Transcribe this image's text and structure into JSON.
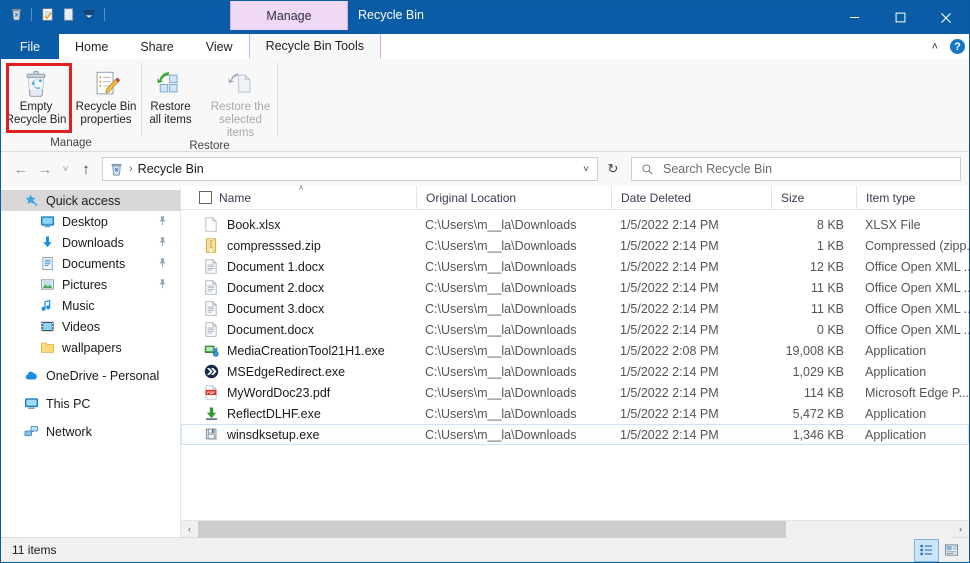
{
  "titlebar": {
    "quick_access": [
      {
        "name": "recycle-bin-icon",
        "label": "Recycle Bin"
      },
      {
        "name": "properties-icon",
        "label": "Properties"
      },
      {
        "name": "new-folder-icon",
        "label": "New folder"
      },
      {
        "name": "customize-dropdown-icon",
        "label": "Customize Quick Access Toolbar"
      }
    ],
    "contextual_tab": "Manage",
    "title": "Recycle Bin",
    "minimize": "–",
    "maximize": "☐",
    "close": "✕"
  },
  "tabs": {
    "file": "File",
    "items": [
      {
        "label": "Home",
        "active": false
      },
      {
        "label": "Share",
        "active": false
      },
      {
        "label": "View",
        "active": false
      },
      {
        "label": "Recycle Bin Tools",
        "active": true
      }
    ],
    "collapse_ribbon": "˄",
    "help": "?"
  },
  "ribbon": {
    "groups": [
      {
        "label": "Manage",
        "buttons": [
          {
            "name": "empty-recycle-bin-button",
            "line1": "Empty",
            "line2": "Recycle Bin",
            "disabled": false,
            "highlighted": true
          },
          {
            "name": "recycle-bin-properties-button",
            "line1": "Recycle Bin",
            "line2": "properties",
            "disabled": false,
            "highlighted": false
          }
        ]
      },
      {
        "label": "Restore",
        "buttons": [
          {
            "name": "restore-all-items-button",
            "line1": "Restore",
            "line2": "all items",
            "disabled": false,
            "highlighted": false
          },
          {
            "name": "restore-selected-items-button",
            "line1": "Restore the",
            "line2": "selected items",
            "disabled": true,
            "highlighted": false
          }
        ]
      }
    ]
  },
  "addressbar": {
    "back": "←",
    "forward": "→",
    "recent": "˅",
    "up": "↑",
    "path": "Recycle Bin",
    "separator": "›",
    "dropdown": "˅",
    "refresh": "↻",
    "search_placeholder": "Search Recycle Bin"
  },
  "sidebar": {
    "items": [
      {
        "label": "Quick access",
        "icon": "star-pin-icon",
        "level": 1,
        "selected": true,
        "pinned": false
      },
      {
        "label": "Desktop",
        "icon": "desktop-icon",
        "level": 2,
        "selected": false,
        "pinned": true
      },
      {
        "label": "Downloads",
        "icon": "download-icon",
        "level": 2,
        "selected": false,
        "pinned": true
      },
      {
        "label": "Documents",
        "icon": "document-icon",
        "level": 2,
        "selected": false,
        "pinned": true
      },
      {
        "label": "Pictures",
        "icon": "picture-icon",
        "level": 2,
        "selected": false,
        "pinned": true
      },
      {
        "label": "Music",
        "icon": "music-icon",
        "level": 2,
        "selected": false,
        "pinned": false
      },
      {
        "label": "Videos",
        "icon": "video-icon",
        "level": 2,
        "selected": false,
        "pinned": false
      },
      {
        "label": "wallpapers",
        "icon": "folder-icon",
        "level": 2,
        "selected": false,
        "pinned": false
      },
      {
        "label": "OneDrive - Personal",
        "icon": "cloud-icon",
        "level": 1,
        "selected": false,
        "pinned": false,
        "gap_before": true
      },
      {
        "label": "This PC",
        "icon": "this-pc-icon",
        "level": 1,
        "selected": false,
        "pinned": false,
        "gap_before": true
      },
      {
        "label": "Network",
        "icon": "network-icon",
        "level": 1,
        "selected": false,
        "pinned": false,
        "gap_before": true
      }
    ]
  },
  "filelist": {
    "columns": [
      {
        "label": "Name",
        "sorted": true
      },
      {
        "label": "Original Location",
        "sorted": false
      },
      {
        "label": "Date Deleted",
        "sorted": false
      },
      {
        "label": "Size",
        "sorted": false
      },
      {
        "label": "Item type",
        "sorted": false
      }
    ],
    "sort_arrow": "˄",
    "rows": [
      {
        "name": "Book.xlsx",
        "icon": "blank-file-icon",
        "location": "C:\\Users\\m__la\\Downloads",
        "date": "1/5/2022 2:14 PM",
        "size": "8 KB",
        "type": "XLSX File",
        "selected": false
      },
      {
        "name": "compresssed.zip",
        "icon": "zip-file-icon",
        "location": "C:\\Users\\m__la\\Downloads",
        "date": "1/5/2022 2:14 PM",
        "size": "1 KB",
        "type": "Compressed (zipp...",
        "selected": false
      },
      {
        "name": "Document 1.docx",
        "icon": "docx-file-icon",
        "location": "C:\\Users\\m__la\\Downloads",
        "date": "1/5/2022 2:14 PM",
        "size": "12 KB",
        "type": "Office Open XML ...",
        "selected": false
      },
      {
        "name": "Document 2.docx",
        "icon": "docx-file-icon",
        "location": "C:\\Users\\m__la\\Downloads",
        "date": "1/5/2022 2:14 PM",
        "size": "11 KB",
        "type": "Office Open XML ...",
        "selected": false
      },
      {
        "name": "Document 3.docx",
        "icon": "docx-file-icon",
        "location": "C:\\Users\\m__la\\Downloads",
        "date": "1/5/2022 2:14 PM",
        "size": "11 KB",
        "type": "Office Open XML ...",
        "selected": false
      },
      {
        "name": "Document.docx",
        "icon": "docx-file-icon",
        "location": "C:\\Users\\m__la\\Downloads",
        "date": "1/5/2022 2:14 PM",
        "size": "0 KB",
        "type": "Office Open XML ...",
        "selected": false
      },
      {
        "name": "MediaCreationTool21H1.exe",
        "icon": "media-tool-icon",
        "location": "C:\\Users\\m__la\\Downloads",
        "date": "1/5/2022 2:08 PM",
        "size": "19,008 KB",
        "type": "Application",
        "selected": false
      },
      {
        "name": "MSEdgeRedirect.exe",
        "icon": "edge-redirect-icon",
        "location": "C:\\Users\\m__la\\Downloads",
        "date": "1/5/2022 2:14 PM",
        "size": "1,029 KB",
        "type": "Application",
        "selected": false
      },
      {
        "name": "MyWordDoc23.pdf",
        "icon": "pdf-file-icon",
        "location": "C:\\Users\\m__la\\Downloads",
        "date": "1/5/2022 2:14 PM",
        "size": "114 KB",
        "type": "Microsoft Edge P...",
        "selected": false
      },
      {
        "name": "ReflectDLHF.exe",
        "icon": "installer-icon",
        "location": "C:\\Users\\m__la\\Downloads",
        "date": "1/5/2022 2:14 PM",
        "size": "5,472 KB",
        "type": "Application",
        "selected": false
      },
      {
        "name": "winsdksetup.exe",
        "icon": "setup-icon",
        "location": "C:\\Users\\m__la\\Downloads",
        "date": "1/5/2022 2:14 PM",
        "size": "1,346 KB",
        "type": "Application",
        "selected": true
      }
    ]
  },
  "scrollbar": {
    "left_arrow": "‹",
    "right_arrow": "›"
  },
  "statusbar": {
    "count": "11 items",
    "views": [
      {
        "name": "details-view-button",
        "active": true
      },
      {
        "name": "large-icons-view-button",
        "active": false
      }
    ]
  },
  "colors": {
    "titlebar": "#0a5ca6",
    "contextual_tab": "#efd9f5",
    "highlight_box": "#e02020",
    "selection": "#cde6f7"
  }
}
